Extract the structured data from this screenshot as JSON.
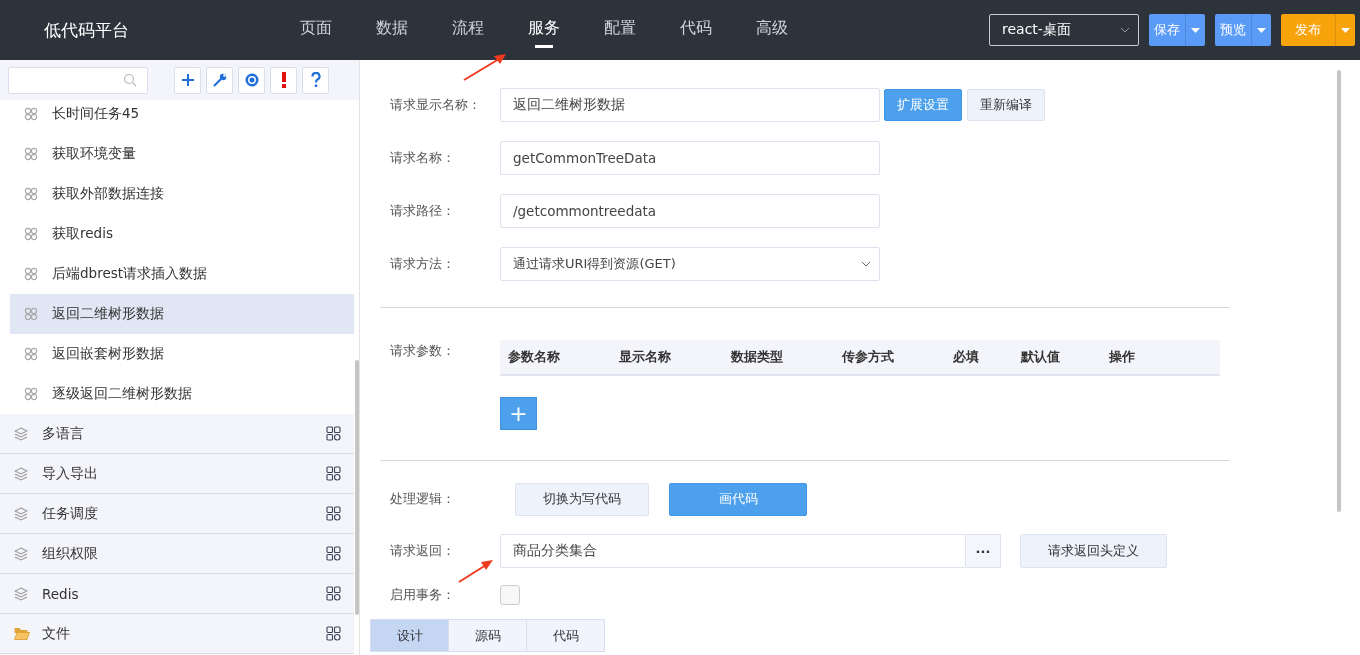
{
  "header": {
    "title": "低代码平台",
    "nav": [
      {
        "label": "页面",
        "selected": false
      },
      {
        "label": "数据",
        "selected": false
      },
      {
        "label": "流程",
        "selected": false
      },
      {
        "label": "服务",
        "selected": true
      },
      {
        "label": "配置",
        "selected": false
      },
      {
        "label": "代码",
        "selected": false
      },
      {
        "label": "高级",
        "selected": false
      }
    ],
    "env_select": {
      "value": "react-桌面"
    },
    "actions": [
      {
        "label": "保存",
        "kind": "primary"
      },
      {
        "label": "预览",
        "kind": "primary"
      },
      {
        "label": "发布",
        "kind": "warning"
      }
    ]
  },
  "sidebar": {
    "services": [
      {
        "label": "长时间任务45",
        "selected": false
      },
      {
        "label": "获取环境变量",
        "selected": false
      },
      {
        "label": "获取外部数据连接",
        "selected": false
      },
      {
        "label": "获取redis",
        "selected": false
      },
      {
        "label": "后端dbrest请求插入数据",
        "selected": false
      },
      {
        "label": "返回二维树形数据",
        "selected": true
      },
      {
        "label": "返回嵌套树形数据",
        "selected": false
      },
      {
        "label": "逐级返回二维树形数据",
        "selected": false
      }
    ],
    "groups": [
      {
        "label": "多语言",
        "kind": "layers"
      },
      {
        "label": "导入导出",
        "kind": "layers"
      },
      {
        "label": "任务调度",
        "kind": "layers"
      },
      {
        "label": "组织权限",
        "kind": "layers"
      },
      {
        "label": "Redis",
        "kind": "layers"
      },
      {
        "label": "文件",
        "kind": "folder"
      }
    ]
  },
  "form": {
    "display_name": {
      "label": "请求显示名称：",
      "value": "返回二维树形数据",
      "buttons": [
        {
          "label": "扩展设置",
          "kind": "primary"
        },
        {
          "label": "重新编译",
          "kind": "default"
        }
      ]
    },
    "name": {
      "label": "请求名称：",
      "value": "getCommonTreeData"
    },
    "path": {
      "label": "请求路径：",
      "value": "/getcommontreedata"
    },
    "method": {
      "label": "请求方法：",
      "value": "通过请求URI得到资源(GET)"
    },
    "params": {
      "label": "请求参数：",
      "columns": [
        "参数名称",
        "显示名称",
        "数据类型",
        "传参方式",
        "必填",
        "默认值",
        "操作"
      ],
      "add_button": "+"
    },
    "logic": {
      "label": "处理逻辑：",
      "options": [
        {
          "label": "切换为写代码",
          "selected": false
        },
        {
          "label": "画代码",
          "selected": true
        }
      ]
    },
    "response": {
      "label": "请求返回：",
      "value": "商品分类集合",
      "more_button": "···",
      "header_button": "请求返回头定义"
    },
    "transaction": {
      "label": "启用事务：",
      "checked": false
    }
  },
  "bottom_tabs": [
    {
      "label": "设计",
      "selected": true
    },
    {
      "label": "源码",
      "selected": false
    },
    {
      "label": "代码",
      "selected": false
    }
  ]
}
